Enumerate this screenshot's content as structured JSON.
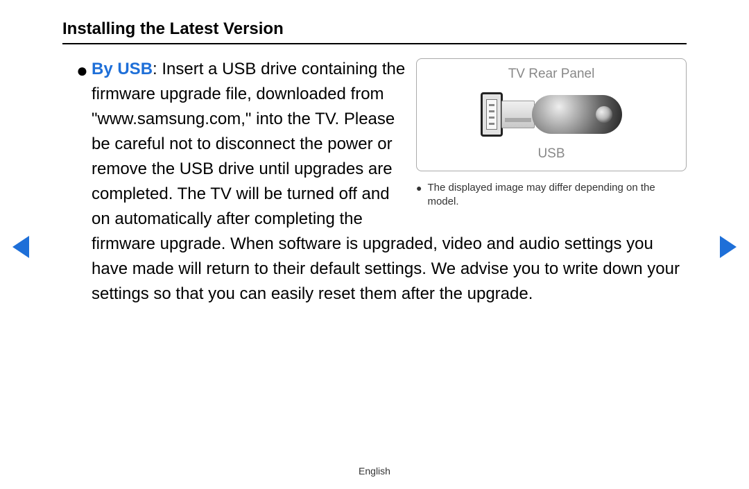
{
  "title": "Installing the Latest Version",
  "bullet_glyph": "●",
  "method_label": "By USB",
  "body_text_after": ": Insert a USB drive containing the firmware upgrade file, downloaded from \"www.samsung.com,\" into the TV. Please be careful not to disconnect the power or remove the USB drive until upgrades are completed. The TV will be turned off and on automatically after completing the firmware upgrade. When software is upgraded, video and audio settings you have made will return to their default settings. We advise you to write down your settings so that you can easily reset them after the upgrade.",
  "diagram": {
    "title": "TV Rear Panel",
    "caption": "USB"
  },
  "note_bullet": "●",
  "note_text": "The displayed image may differ depending on the model.",
  "footer": "English"
}
